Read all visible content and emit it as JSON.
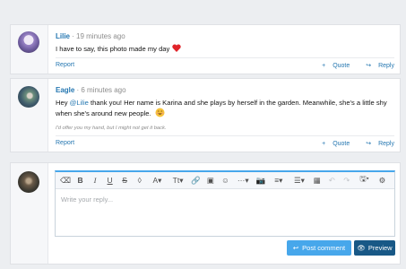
{
  "posts": [
    {
      "author": "Lilie",
      "time": "19 minutes ago",
      "message": "I have to say, this photo made my day",
      "report": "Report",
      "quote": "Quote",
      "reply": "Reply"
    },
    {
      "author": "Eagle",
      "time": "6 minutes ago",
      "message_prefix": "Hey",
      "mention": "@Lilie",
      "message_main": "thank you! Her name is Karina and she plays by herself in the garden. Meanwhile, she's a little shy when she's around new people.",
      "signature": "I'd offer you my hand, but I might not get it back.",
      "report": "Report",
      "quote": "Quote",
      "reply": "Reply"
    }
  ],
  "composer": {
    "placeholder": "Write your reply...",
    "post_button": "Post comment",
    "preview_button": "Preview",
    "toolbar_icons": [
      "eraser-icon",
      "bold-icon",
      "italic-icon",
      "underline-icon",
      "strikethrough-icon",
      "text-color-icon",
      "font-family-icon",
      "font-size-icon",
      "link-icon",
      "image-icon",
      "emoji-icon",
      "more-icon",
      "camera-icon",
      "align-icon",
      "list-icon",
      "table-icon",
      "undo-icon",
      "redo-icon",
      "drafts-icon",
      "settings-icon"
    ]
  },
  "colors": {
    "accent": "#2577b1",
    "button_post": "#47a7eb",
    "button_preview": "#185886"
  }
}
